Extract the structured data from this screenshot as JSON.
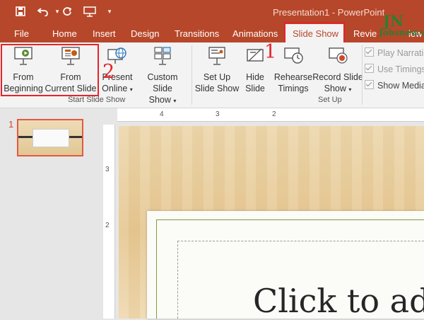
{
  "window": {
    "title": "Presentation1  -  PowerPoint"
  },
  "tabs": {
    "file": "File",
    "home": "Home",
    "insert": "Insert",
    "design": "Design",
    "transitions": "Transitions",
    "animations": "Animations",
    "slide_show": "Slide Show",
    "review_partial": "Revie",
    "view_partial": "iew"
  },
  "ribbon": {
    "start_slide_show": {
      "label": "Start Slide Show",
      "from_beginning": [
        "From",
        "Beginning"
      ],
      "from_current": [
        "From",
        "Current Slide"
      ],
      "present_online": [
        "Present",
        "Online"
      ],
      "custom_slide_show": [
        "Custom Slide",
        "Show"
      ]
    },
    "set_up": {
      "label": "Set Up",
      "set_up_slide_show": [
        "Set Up",
        "Slide Show"
      ],
      "hide_slide": [
        "Hide",
        "Slide"
      ],
      "rehearse_timings": [
        "Rehearse",
        "Timings"
      ],
      "record_slide_show": [
        "Record Slide",
        "Show"
      ],
      "checkboxes": [
        "Play Narrati",
        "Use Timings",
        "Show Media"
      ]
    }
  },
  "annotations": {
    "callout_1": "1",
    "callout_2": "2"
  },
  "rulers": {
    "h": [
      "4",
      "3",
      "2"
    ],
    "v": [
      "3",
      "2"
    ]
  },
  "thumbnails": {
    "slide_number": "1"
  },
  "slide": {
    "title": "Click to ad"
  },
  "watermark": {
    "letters": "JN",
    "site": "Jobsnew.vn"
  },
  "colors": {
    "accent": "#b7472a",
    "highlight": "#e4242b",
    "ribbon_bg": "#f3f3f3"
  },
  "icons": [
    "save-icon",
    "undo-icon",
    "redo-icon",
    "present-from-icon",
    "customize-qat-icon"
  ]
}
